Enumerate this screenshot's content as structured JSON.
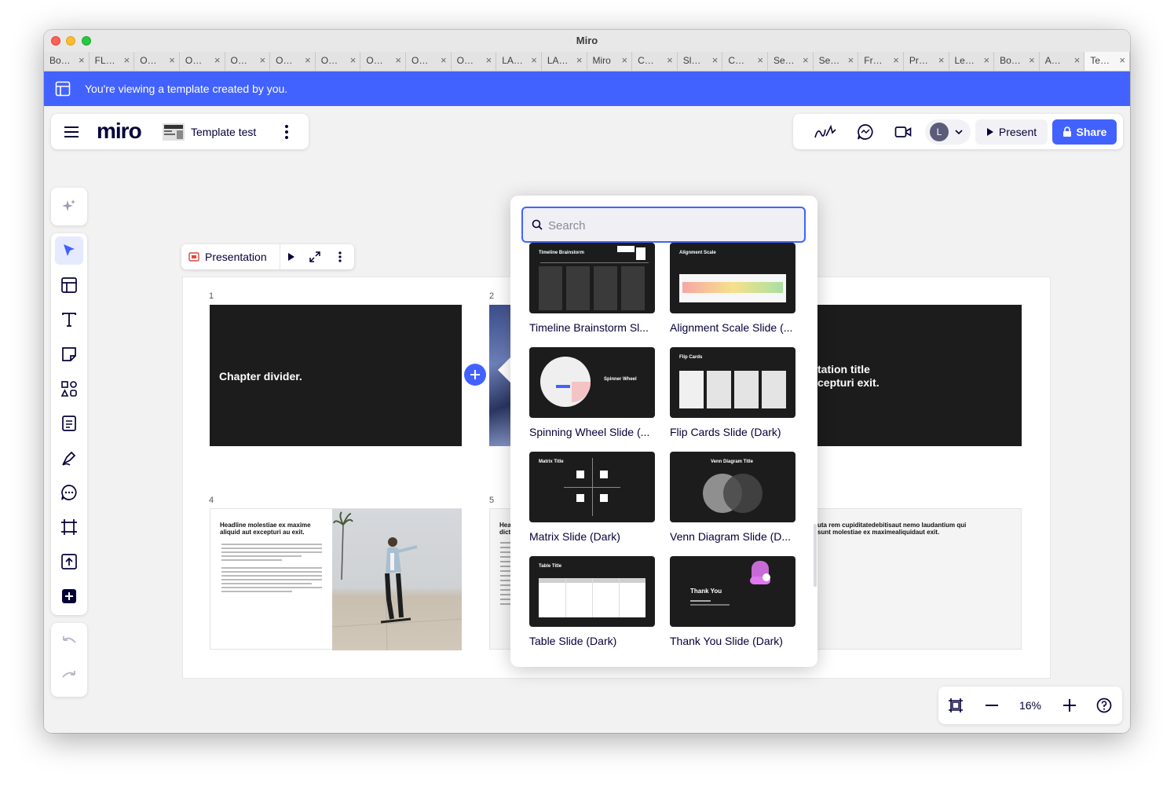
{
  "window": {
    "title": "Miro"
  },
  "tabs": [
    {
      "label": "Bo…"
    },
    {
      "label": "FL…"
    },
    {
      "label": "O…"
    },
    {
      "label": "O…"
    },
    {
      "label": "O…"
    },
    {
      "label": "O…"
    },
    {
      "label": "O…"
    },
    {
      "label": "O…"
    },
    {
      "label": "O…"
    },
    {
      "label": "O…"
    },
    {
      "label": "LA…"
    },
    {
      "label": "LA…"
    },
    {
      "label": "Miro"
    },
    {
      "label": "C…"
    },
    {
      "label": "Sl…"
    },
    {
      "label": "C…"
    },
    {
      "label": "Se…"
    },
    {
      "label": "Se…"
    },
    {
      "label": "Fr…"
    },
    {
      "label": "Pr…"
    },
    {
      "label": "Le…"
    },
    {
      "label": "Bo…"
    },
    {
      "label": "A…"
    },
    {
      "label": "Te…"
    }
  ],
  "banner": {
    "text": "You're viewing a template created by you."
  },
  "header": {
    "logo": "miro",
    "board_name": "Template test",
    "avatar_initial": "L",
    "present_label": "Present",
    "share_label": "Share"
  },
  "presentation_bar": {
    "label": "Presentation"
  },
  "slides": {
    "s1": {
      "num": "1",
      "title": "Chapter divider."
    },
    "s2": {
      "num": "2"
    },
    "s3": {
      "title_line1": "tation title",
      "title_line2": "cepturi exit."
    },
    "s4": {
      "num": "4",
      "headline": "Headline molestiae ex maxime aliquid aut excepturi au exit."
    },
    "s5": {
      "num": "5",
      "headline": "Hea dict"
    },
    "s6": {
      "headline": "uta rem cupiditatedebitisaut nemo laudantium qui sunt molestiae ex maximealiquidaut exit."
    }
  },
  "search": {
    "placeholder": "Search",
    "value": ""
  },
  "templates": [
    {
      "label": "Timeline Brainstorm Sl...",
      "thumb_title": "Timeline Brainstorm"
    },
    {
      "label": "Alignment Scale Slide (...",
      "thumb_title": "Alignment Scale"
    },
    {
      "label": "Spinning Wheel Slide (...",
      "thumb_title": "Spinner Wheel"
    },
    {
      "label": "Flip Cards Slide (Dark)",
      "thumb_title": "Flip Cards"
    },
    {
      "label": "Matrix Slide (Dark)",
      "thumb_title": "Matrix Title"
    },
    {
      "label": "Venn Diagram Slide (D...",
      "thumb_title": "Venn Diagram Title"
    },
    {
      "label": "Table Slide (Dark)",
      "thumb_title": "Table Title"
    },
    {
      "label": "Thank You Slide (Dark)",
      "thumb_title": "Thank You"
    }
  ],
  "zoom": {
    "value": "16%"
  },
  "colors": {
    "accent": "#4262ff",
    "dark_slide": "#1c1c1c",
    "canvas": "#f2f2f2"
  }
}
